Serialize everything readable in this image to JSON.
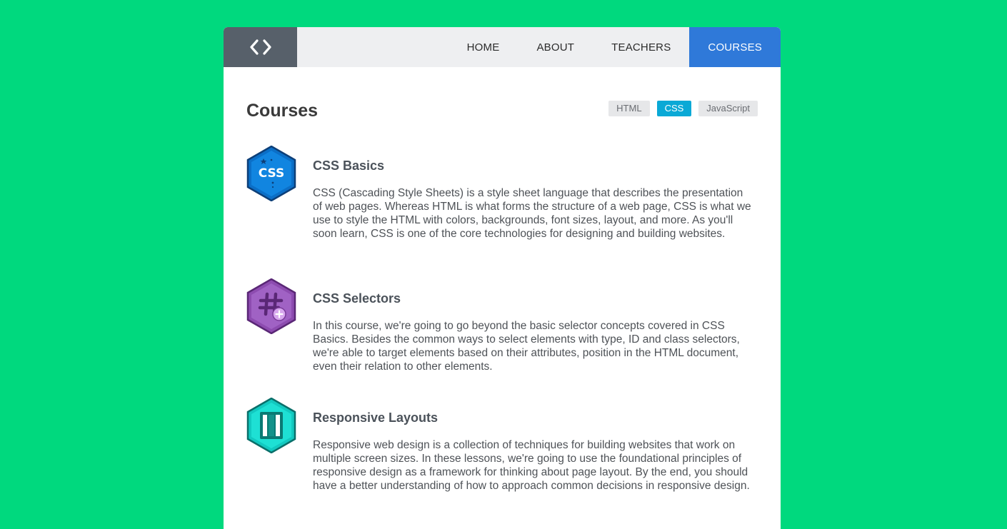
{
  "nav": {
    "items": [
      {
        "label": "HOME",
        "active": false
      },
      {
        "label": "ABOUT",
        "active": false
      },
      {
        "label": "TEACHERS",
        "active": false
      },
      {
        "label": "COURSES",
        "active": true
      }
    ]
  },
  "main": {
    "title": "Courses",
    "tags": [
      {
        "label": "HTML",
        "active": false
      },
      {
        "label": "CSS",
        "active": true
      },
      {
        "label": "JavaScript",
        "active": false
      }
    ],
    "courses": [
      {
        "title": "CSS Basics",
        "icon": "css-badge-icon",
        "icon_text": "CSS",
        "description": "CSS (Cascading Style Sheets) is a style sheet language that describes the presentation of web pages. Whereas HTML is what forms the structure of a web page, CSS is what we use to style the HTML with colors, backgrounds, font sizes, layout, and more. As you'll soon learn, CSS is one of the core technologies for designing and building websites."
      },
      {
        "title": "CSS Selectors",
        "icon": "selector-badge-icon",
        "description": "In this course, we're going to go beyond the basic selector concepts covered in CSS Basics. Besides the common ways to select elements with type, ID and class selectors, we're able to target elements based on their attributes, position in the HTML document, even their relation to other elements."
      },
      {
        "title": "Responsive Layouts",
        "icon": "responsive-badge-icon",
        "description": "Responsive web design is a collection of techniques for building websites that work on multiple screen sizes. In these lessons, we're going to use the foundational principles of responsive design as a framework for thinking about page layout. By the end, you should have a better understanding of how to approach common decisions in responsive design."
      }
    ]
  },
  "colors": {
    "background": "#00d97e",
    "nav_active": "#2f79d9",
    "tag_active": "#0aa9d6",
    "logo_bg": "#57606a"
  }
}
